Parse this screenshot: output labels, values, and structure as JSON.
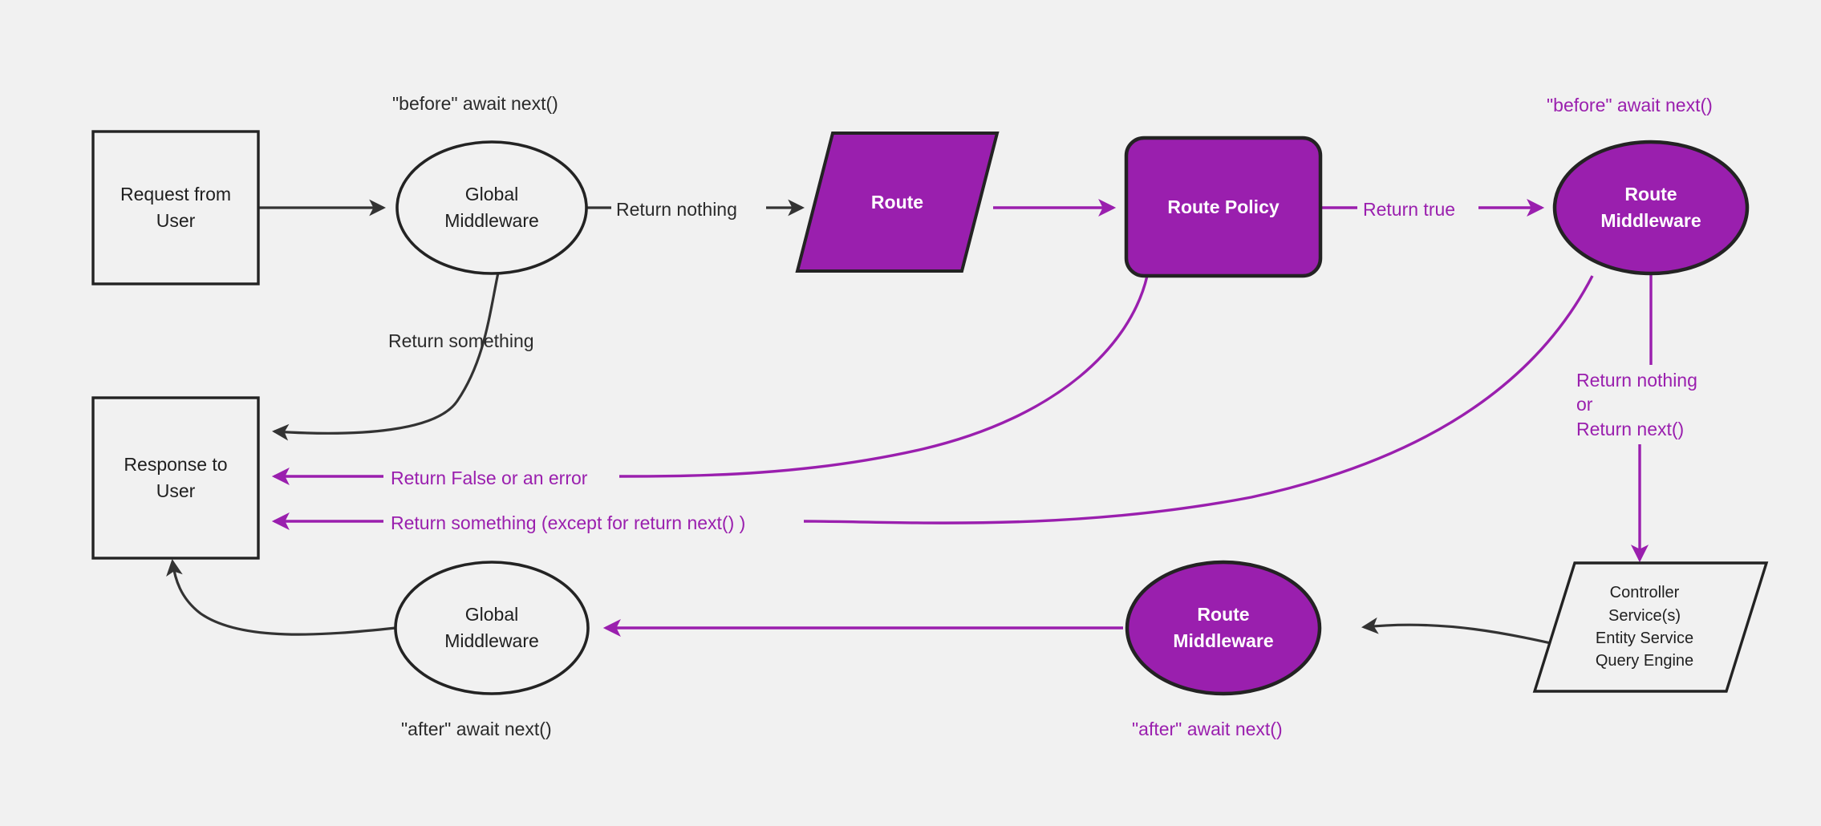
{
  "colors": {
    "background": "#f1f1f1",
    "stroke_dark": "#232323",
    "purple": "#9A1FAE",
    "node_fill_light": "#f1f1f1",
    "text_dark": "#1f1f1f",
    "text_light": "#ffffff"
  },
  "nodes": {
    "request_from_user": {
      "line1": "Request from",
      "line2": "User"
    },
    "global_middleware_top": {
      "line1": "Global",
      "line2": "Middleware"
    },
    "route": {
      "label": "Route"
    },
    "route_policy": {
      "label": "Route Policy"
    },
    "route_middleware_top": {
      "line1": "Route",
      "line2": "Middleware"
    },
    "response_to_user": {
      "line1": "Response to",
      "line2": "User"
    },
    "global_middleware_bottom": {
      "line1": "Global",
      "line2": "Middleware"
    },
    "route_middleware_bottom": {
      "line1": "Route",
      "line2": "Middleware"
    },
    "controller_stack": {
      "line1": "Controller",
      "line2": "Service(s)",
      "line3": "Entity Service",
      "line4": "Query Engine"
    }
  },
  "annotations": {
    "before_await_next_global": "\"before\" await next()",
    "before_await_next_route": "\"before\" await next()",
    "after_await_next_global": "\"after\" await next()",
    "after_await_next_route": "\"after\" await next()"
  },
  "edges": {
    "return_nothing": "Return nothing",
    "return_something": "Return something",
    "return_true": "Return true",
    "return_false_or_error": "Return False or an error",
    "return_something_except_next": "Return something (except for return next() )",
    "return_nothing_or_next": {
      "line1": "Return nothing",
      "line2": "or",
      "line3": "Return next()"
    }
  }
}
